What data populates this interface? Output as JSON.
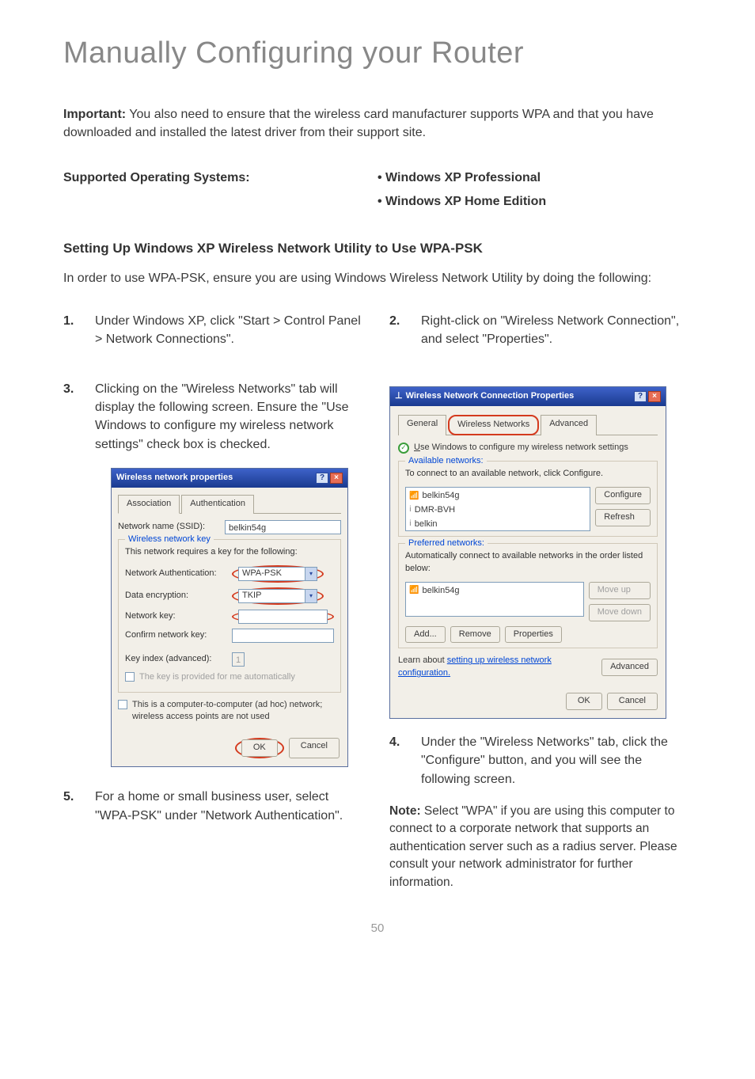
{
  "page_title": "Manually Configuring your Router",
  "important": {
    "label": "Important:",
    "text": " You also need to ensure that the wireless card manufacturer supports WPA and that you have downloaded and installed the latest driver from their support site."
  },
  "os": {
    "heading": "Supported Operating Systems:",
    "items": [
      "• Windows XP Professional",
      "• Windows XP Home Edition"
    ]
  },
  "setting_title": "Setting Up Windows XP Wireless Network Utility to Use WPA-PSK",
  "intro": "In order to use WPA-PSK, ensure you are using Windows Wireless Network Utility by doing the following:",
  "steps": {
    "s1": {
      "num": "1.",
      "text": "Under Windows XP, click \"Start > Control Panel >\nNetwork Connections\"."
    },
    "s2": {
      "num": "2.",
      "text": "Right-click on \"Wireless Network Connection\", and\nselect \"Properties\"."
    },
    "s3": {
      "num": "3.",
      "text": "Clicking on the \"Wireless Networks\" tab will display the following screen. Ensure the \"Use Windows to configure my wireless network settings\" check box is checked."
    },
    "s4": {
      "num": "4.",
      "text": "Under the \"Wireless Networks\" tab, click the \"Configure\" button, and you will see the following screen."
    },
    "s5": {
      "num": "5.",
      "text": "For a home or small business user, select \"WPA-PSK\" under \"Network Authentication\"."
    }
  },
  "note": {
    "label": "Note:",
    "text": " Select \"WPA\" if you are using this computer to connect to a corporate network that supports an authentication server such as a radius server. Please consult your network administrator for further information."
  },
  "page_num": "50",
  "dlg1": {
    "title": "Wireless network properties",
    "tabs": [
      "Association",
      "Authentication"
    ],
    "ssid_label": "Network name (SSID):",
    "ssid_value": "belkin54g",
    "fieldset_legend": "Wireless network key",
    "fieldset_info": "This network requires a key for the following:",
    "auth_label": "Network Authentication:",
    "auth_value": "WPA-PSK",
    "enc_label": "Data encryption:",
    "enc_value": "TKIP",
    "key_label": "Network key:",
    "confirm_label": "Confirm network key:",
    "keyidx_label": "Key index (advanced):",
    "keyidx_value": "1",
    "auto_chk": "The key is provided for me automatically",
    "adhoc_chk": "This is a computer-to-computer (ad hoc) network; wireless access points are not used",
    "ok": "OK",
    "cancel": "Cancel"
  },
  "dlg2": {
    "title": "Wireless Network Connection Properties",
    "tabs": [
      "General",
      "Wireless Networks",
      "Advanced"
    ],
    "use_windows": "Use Windows to configure my wireless network settings",
    "available_legend": "Available networks:",
    "available_info": "To connect to an available network, click Configure.",
    "available_list": [
      "belkin54g",
      "DMR-BVH",
      "belkin"
    ],
    "configure": "Configure",
    "refresh": "Refresh",
    "preferred_legend": "Preferred networks:",
    "preferred_info": "Automatically connect to available networks in the order listed below:",
    "preferred_list": [
      "belkin54g"
    ],
    "move_up": "Move up",
    "move_down": "Move down",
    "add": "Add...",
    "remove": "Remove",
    "properties": "Properties",
    "learn": "Learn about ",
    "learn_link": "setting up wireless network configuration.",
    "advanced": "Advanced",
    "ok": "OK",
    "cancel": "Cancel"
  }
}
